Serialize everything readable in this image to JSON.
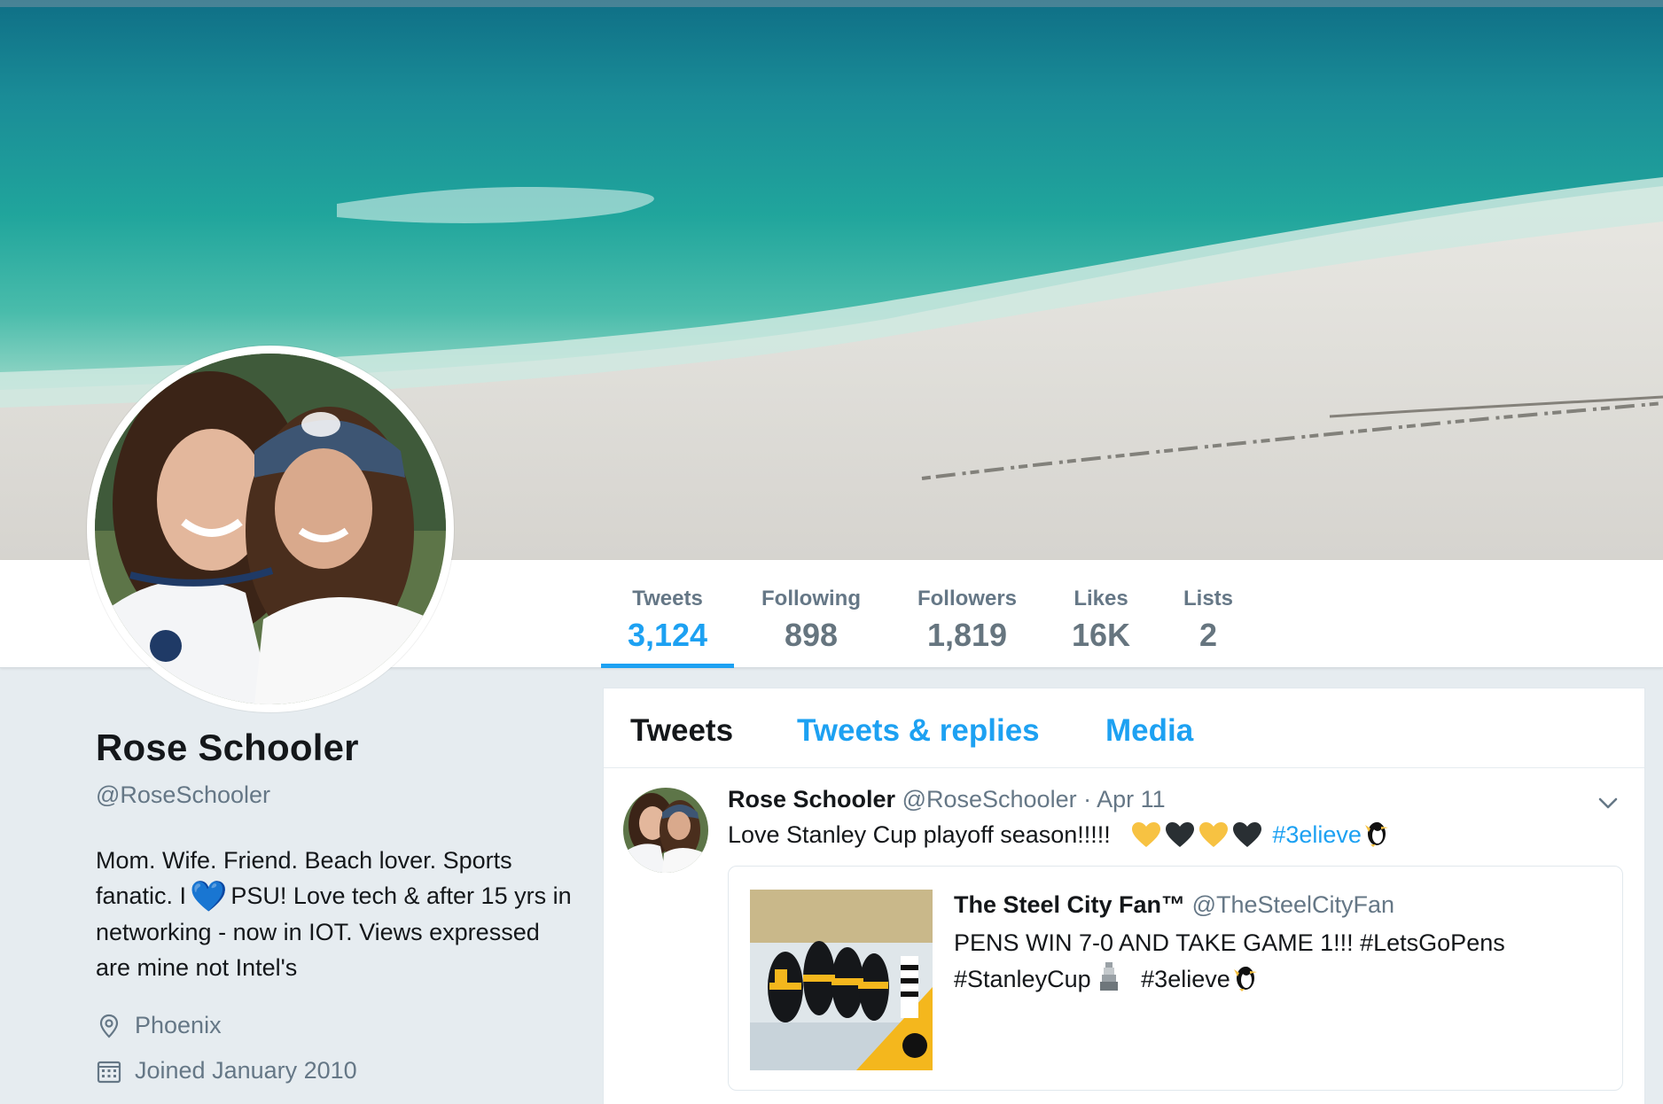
{
  "profile": {
    "name": "Rose Schooler",
    "handle": "@RoseSchooler",
    "bio_part1": "Mom. Wife. Friend. Beach lover. Sports fanatic. I",
    "bio_heart": "💙",
    "bio_part2": "PSU! Love tech & after 15 yrs in networking - now in IOT. Views expressed are mine not Intel's",
    "location": "Phoenix",
    "joined": "Joined January 2010",
    "location_icon": "map-pin-icon",
    "joined_icon": "calendar-icon"
  },
  "stats": [
    {
      "label": "Tweets",
      "value": "3,124",
      "active": true
    },
    {
      "label": "Following",
      "value": "898"
    },
    {
      "label": "Followers",
      "value": "1,819"
    },
    {
      "label": "Likes",
      "value": "16K"
    },
    {
      "label": "Lists",
      "value": "2"
    }
  ],
  "tabs": {
    "tweets": "Tweets",
    "replies": "Tweets & replies",
    "media": "Media"
  },
  "tweet": {
    "name": "Rose Schooler",
    "handle": "@RoseSchooler",
    "time": "· Apr 11",
    "text": "Love Stanley Cup playoff season!!!!!",
    "hashtag": "#3elieve",
    "heart_colors": [
      "#f7c242",
      "#292f33",
      "#f7c242",
      "#292f33"
    ],
    "menu_icon": "chevron-down-icon",
    "quote": {
      "name": "The Steel City Fan™",
      "handle": "@TheSteelCityFan",
      "line1": "PENS WIN 7-0 AND TAKE GAME 1!!! #LetsGoPens",
      "line2a": "#StanleyCup",
      "line2b": "#3elieve",
      "trophy_icon": "trophy-icon",
      "penguin_icon": "penguin-icon"
    }
  },
  "colors": {
    "accent": "#1da1f2",
    "muted": "#657786",
    "text": "#14171a",
    "background": "#e6ecf0"
  }
}
